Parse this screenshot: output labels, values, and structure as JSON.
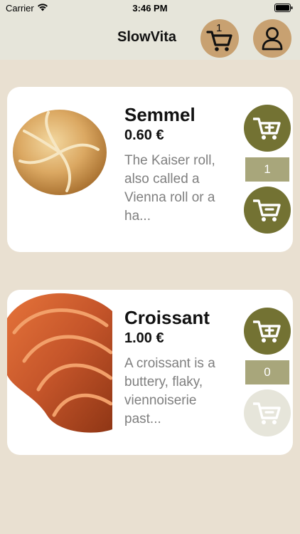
{
  "status_bar": {
    "carrier": "Carrier",
    "time": "3:46 PM"
  },
  "nav": {
    "title": "SlowVita",
    "cart_count": "1",
    "cart_icon": "cart-icon",
    "profile_icon": "person-icon"
  },
  "products": [
    {
      "name": "Semmel",
      "price": "0.60 €",
      "description": "The Kaiser roll, also called a Vienna roll or a ha...",
      "quantity": "1",
      "remove_enabled": true
    },
    {
      "name": "Croissant",
      "price": "1.00 €",
      "description": "A croissant is a buttery, flaky, viennoiserie past...",
      "quantity": "0",
      "remove_enabled": false
    }
  ],
  "colors": {
    "background": "#e9e0d1",
    "bar": "#e6e5da",
    "accent_olive": "#737233",
    "quantity_box": "#a8a67b",
    "nav_circle": "#c8a171"
  }
}
